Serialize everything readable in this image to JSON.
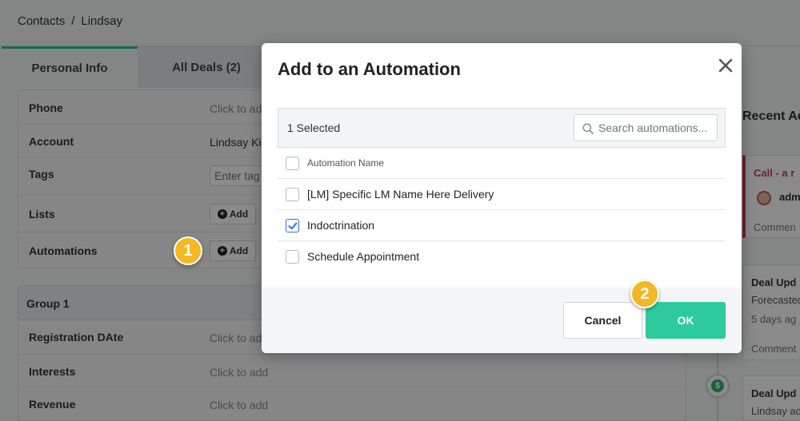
{
  "breadcrumb": {
    "root": "Contacts",
    "separator": "/",
    "current": "Lindsay"
  },
  "tabs": [
    {
      "label": "Personal Info",
      "active": true
    },
    {
      "label": "All Deals (2)",
      "active": false
    }
  ],
  "personal_info": {
    "rows": {
      "phone": {
        "label": "Phone",
        "value": "Click to add"
      },
      "account": {
        "label": "Account",
        "value": "Lindsay Ki"
      },
      "tags": {
        "label": "Tags",
        "placeholder": "Enter tag"
      },
      "lists": {
        "label": "Lists",
        "button": "Add"
      },
      "automations": {
        "label": "Automations",
        "button": "Add"
      }
    }
  },
  "group": {
    "title": "Group 1",
    "rows": {
      "registration": {
        "label": "Registration DAte",
        "value": "Click to add"
      },
      "interests": {
        "label": "Interests",
        "value": "Click to add"
      },
      "revenue": {
        "label": "Revenue",
        "value": "Click to add"
      }
    }
  },
  "activity": {
    "title": "Recent Ac",
    "items": [
      {
        "title": "Call - a r",
        "user": "adm",
        "note": "Commen"
      },
      {
        "title": "Deal Upd",
        "line": "Forecasted",
        "time": "5 days ag",
        "note": "Comment"
      },
      {
        "title": "Deal Upd",
        "line": "Lindsay ad"
      }
    ]
  },
  "callouts": {
    "one": "1",
    "two": "2"
  },
  "modal": {
    "title": "Add to an Automation",
    "selected_count": "1 Selected",
    "search_placeholder": "Search automations...",
    "column_header": "Automation Name",
    "automations": [
      {
        "name": "[LM] Specific LM Name Here Delivery",
        "checked": false
      },
      {
        "name": "Indoctrination",
        "checked": true
      },
      {
        "name": "Schedule Appointment",
        "checked": false
      }
    ],
    "cancel_label": "Cancel",
    "ok_label": "OK"
  },
  "colors": {
    "accent": "#2dcb9b",
    "callout": "#f4b824",
    "check": "#2a6fd6",
    "activity_red": "#d13b5c"
  },
  "icons": {
    "close": "close-icon",
    "search": "search-icon",
    "check": "check-icon",
    "plus": "plus-circle-icon",
    "dollar": "dollar-icon"
  }
}
